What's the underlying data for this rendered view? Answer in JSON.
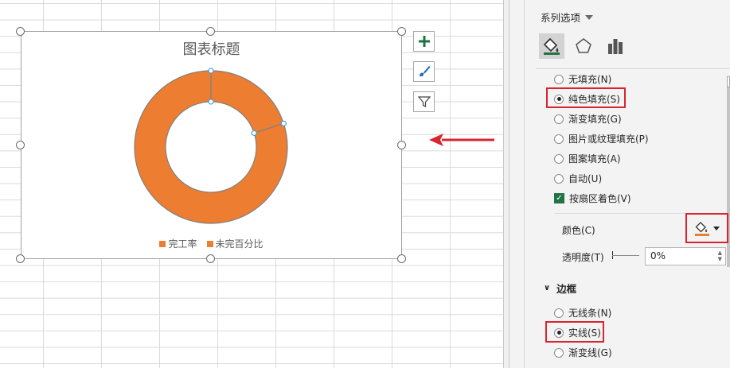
{
  "chart": {
    "title": "图表标题",
    "legend": [
      "完工率",
      "未完百分比"
    ],
    "colors": {
      "series": "#ed7d31",
      "selection_handle": "#4a9edd"
    }
  },
  "chart_data": {
    "type": "pie",
    "title": "图表标题",
    "categories": [
      "完工率",
      "未完百分比"
    ],
    "values": [
      20,
      80
    ],
    "style": "doughnut"
  },
  "chart_tools": [
    "add-chart-element-icon",
    "chart-styles-brush-icon",
    "chart-filter-icon"
  ],
  "pane": {
    "header": "系列选项",
    "tabs": [
      "fill-line-icon",
      "effects-pentagon-icon",
      "series-options-bar-icon"
    ],
    "fill_options": [
      {
        "label": "无填充(N)",
        "selected": false
      },
      {
        "label": "纯色填充(S)",
        "selected": true
      },
      {
        "label": "渐变填充(G)",
        "selected": false
      },
      {
        "label": "图片或纹理填充(P)",
        "selected": false
      },
      {
        "label": "图案填充(A)",
        "selected": false
      },
      {
        "label": "自动(U)",
        "selected": false
      }
    ],
    "vary_by_point": {
      "label": "按扇区着色(V)",
      "checked": true
    },
    "color_label": "颜色(C)",
    "transparency_label": "透明度(T)",
    "transparency_value": "0%",
    "border_section": "边框",
    "border_options": [
      {
        "label": "无线条(N)",
        "selected": false
      },
      {
        "label": "实线(S)",
        "selected": true
      },
      {
        "label": "渐变线(G)",
        "selected": false
      }
    ]
  },
  "annotation": {
    "arrow_color": "#d9242f",
    "highlight_color": "#d9242f"
  }
}
